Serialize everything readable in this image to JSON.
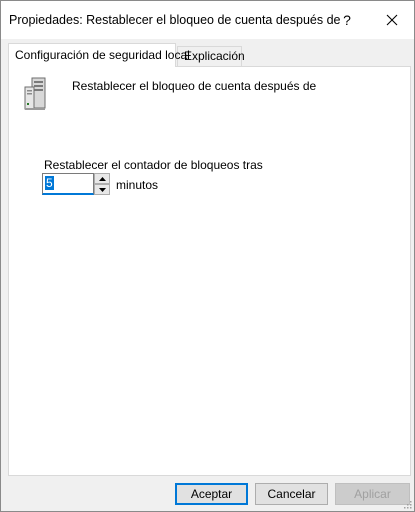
{
  "window": {
    "title": "Propiedades: Restablecer el bloqueo de cuenta después de",
    "help_glyph": "?",
    "close_glyph": "✕"
  },
  "tabs": [
    {
      "label": "Configuración de seguridad local",
      "active": true
    },
    {
      "label": "Explicación",
      "active": false
    }
  ],
  "policy": {
    "icon": "server-policy-icon",
    "title": "Restablecer el bloqueo de cuenta después de"
  },
  "setting": {
    "label": "Restablecer el contador de bloqueos tras",
    "value": "5",
    "unit": "minutos"
  },
  "buttons": {
    "ok": "Aceptar",
    "cancel": "Cancelar",
    "apply": "Aplicar"
  },
  "colors": {
    "accent": "#0078d7",
    "window_bg": "#f0f0f0",
    "panel_bg": "#ffffff"
  }
}
